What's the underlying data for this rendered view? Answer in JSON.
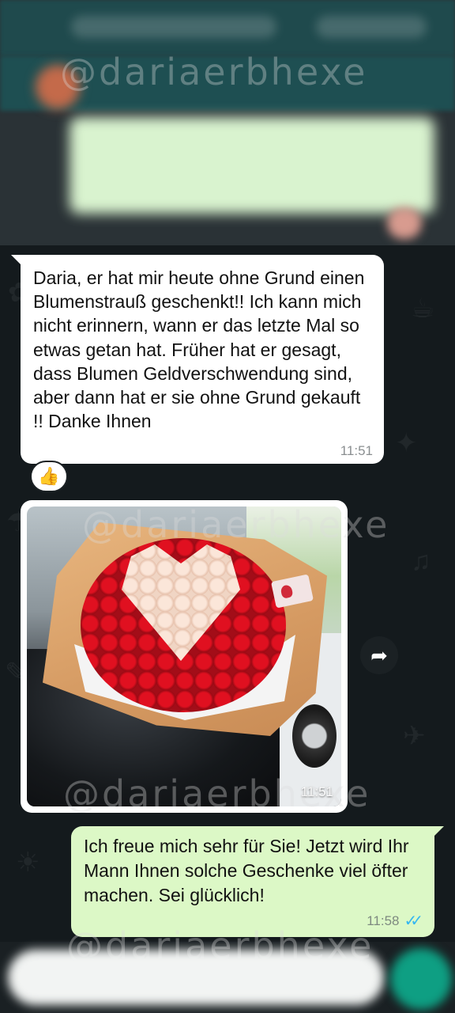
{
  "watermark": "@dariaerbhexe",
  "messages": [
    {
      "direction": "incoming",
      "text": "Daria, er hat mir heute ohne Grund einen Blumenstrauß geschenkt!! Ich kann mich nicht erinnern, wann er das letzte Mal so etwas getan hat. Früher hat er gesagt, dass Blumen Geldverschwendung sind, aber dann hat er sie ohne Grund gekauft !! Danke Ihnen",
      "time": "11:51",
      "reaction": "👍"
    },
    {
      "direction": "incoming",
      "type": "image",
      "image_description": "bouquet-of-red-and-cream-roses",
      "time": "11:51"
    },
    {
      "direction": "outgoing",
      "text": "Ich freue mich sehr für Sie! Jetzt wird Ihr Mann Ihnen solche Geschenke viel öfter machen. Sei glücklich!",
      "time": "11:58",
      "status": "read"
    }
  ],
  "colors": {
    "incoming_bubble": "#ffffff",
    "outgoing_bubble": "#dcf8c6",
    "chat_background": "#141a1d",
    "read_ticks": "#34b7f1",
    "send_button": "#0e9f83"
  },
  "icons": {
    "forward": "forward-arrow-icon",
    "read_status": "double-check-icon"
  }
}
